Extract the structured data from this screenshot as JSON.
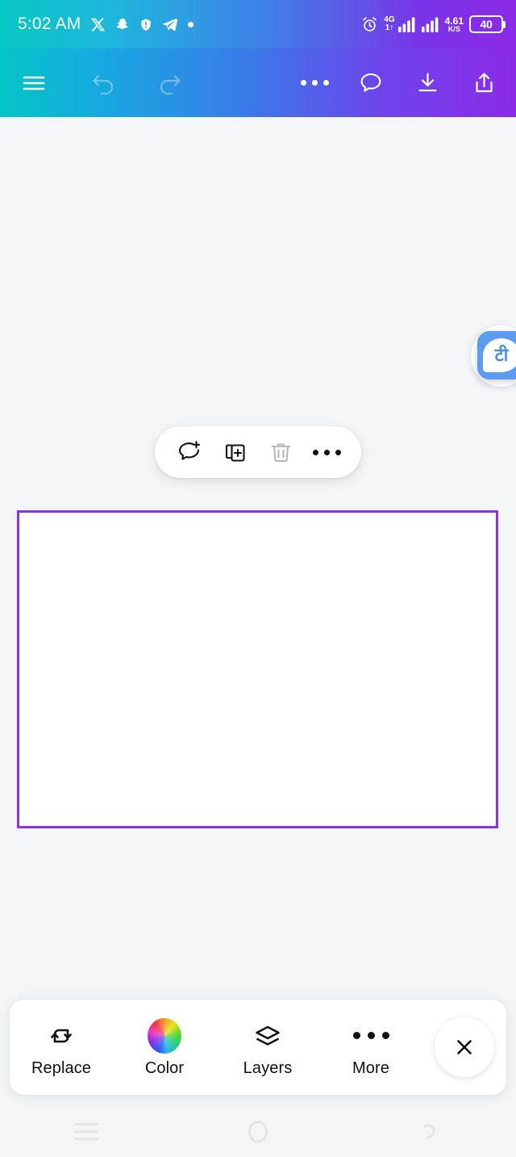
{
  "status_bar": {
    "time": "5:02 AM",
    "left_icons": [
      {
        "name": "x-twitter-icon",
        "label": "X"
      },
      {
        "name": "snapchat-icon",
        "label": "Snapchat"
      },
      {
        "name": "security-shield-icon",
        "label": "Security alert"
      },
      {
        "name": "telegram-icon",
        "label": "Telegram"
      },
      {
        "name": "status-dot-icon",
        "label": "More notifications"
      }
    ],
    "alarm": "alarm-clock-icon",
    "network_generation": "4G",
    "network_arrows": "1↑",
    "signal_1": "signal-bars-icon",
    "signal_2": "signal-bars-icon",
    "data_speed_value": "4.61",
    "data_speed_unit": "K/S",
    "battery_level": "40"
  },
  "toolbar": {
    "menu": "menu-icon",
    "undo": "undo-icon",
    "redo": "redo-icon",
    "more": "more-options-icon",
    "comment": "comment-icon",
    "download": "download-icon",
    "share": "share-icon"
  },
  "floating_bubble": {
    "character": "टी"
  },
  "context_toolbar": {
    "add_comment": "add-comment-icon",
    "duplicate": "duplicate-icon",
    "delete": "delete-icon",
    "more": "more-options-icon"
  },
  "canvas": {
    "selected_element": "white-rectangle",
    "selection_color": "#8b33e6"
  },
  "bottom_bar": {
    "items": [
      {
        "label": "Replace",
        "icon": "replace-icon"
      },
      {
        "label": "Color",
        "icon": "color-wheel-icon"
      },
      {
        "label": "Layers",
        "icon": "layers-icon"
      },
      {
        "label": "More",
        "icon": "more-options-icon"
      }
    ],
    "close": "close-icon"
  },
  "nav_bar": {
    "recents": "recents-icon",
    "home": "home-icon",
    "back": "back-icon"
  }
}
